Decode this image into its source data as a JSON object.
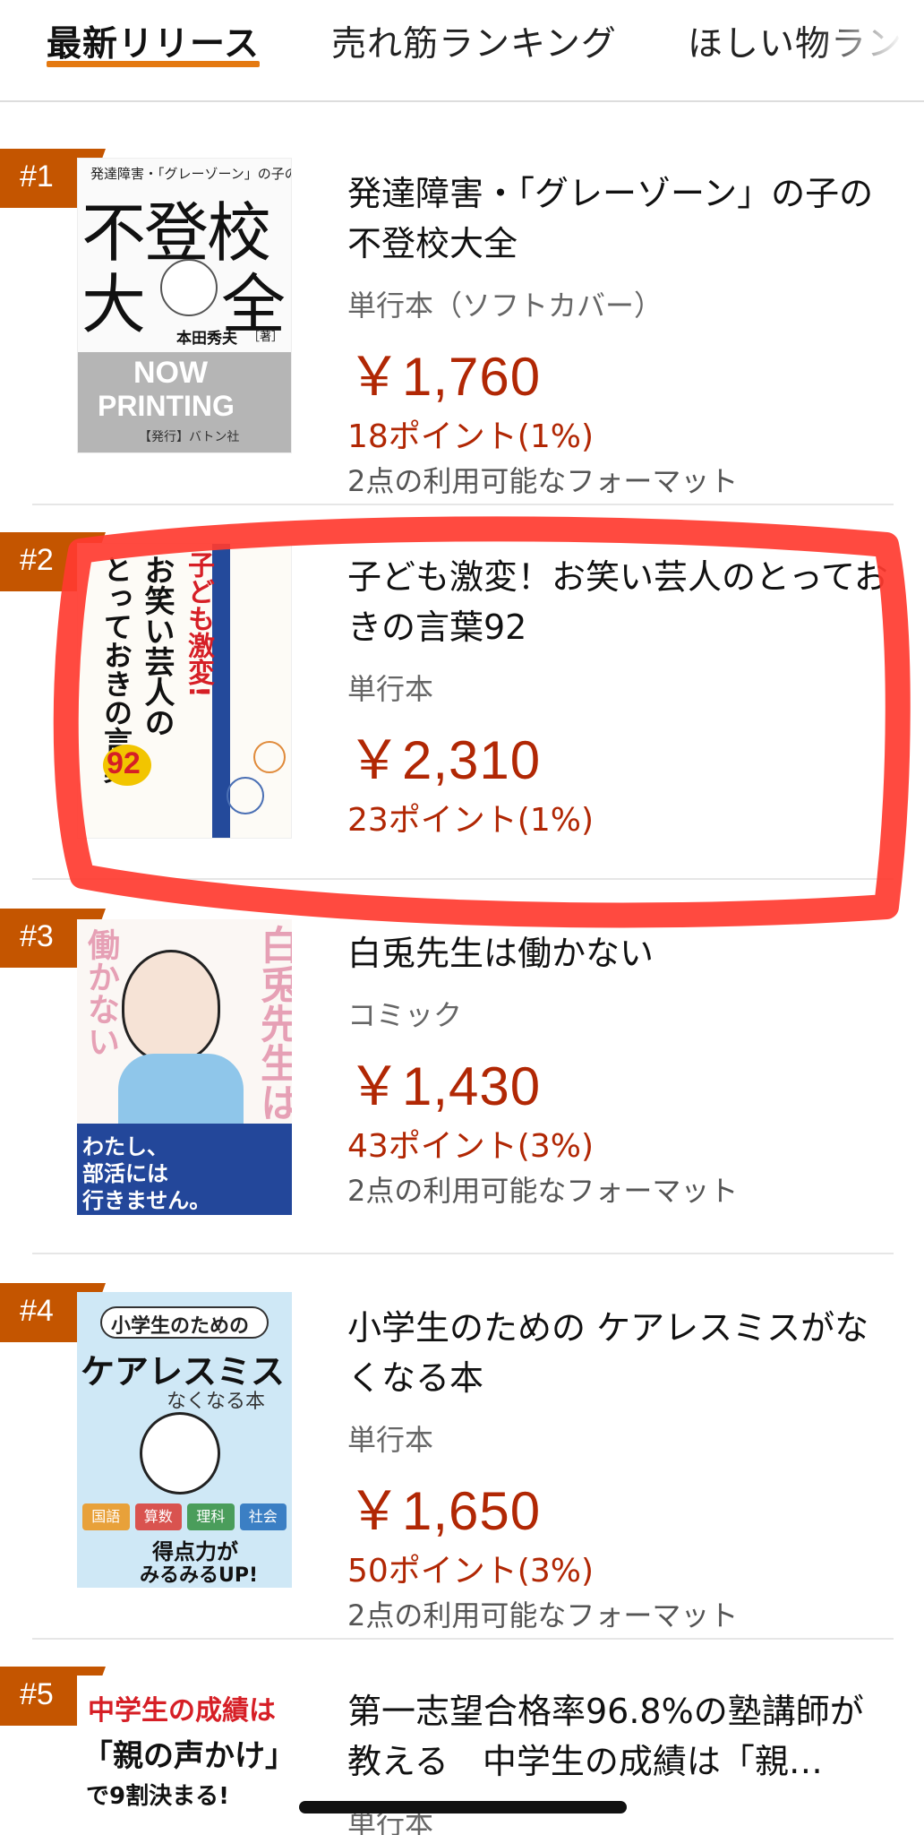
{
  "tabs": [
    {
      "label": "最新リリース"
    },
    {
      "label": "売れ筋ランキング"
    },
    {
      "label": "ほしい物ランキング"
    }
  ],
  "items": [
    {
      "rank": "#1",
      "title": "発達障害・「グレーゾーン」の子の不登校大全",
      "format": "単行本（ソフトカバー）",
      "price": "￥1,760",
      "points": "18ポイント(1%)",
      "availability": "2点の利用可能なフォーマット",
      "cover": {
        "top_text": "発達障害・「グレーゾーン」の子の",
        "big1": "不登校",
        "big2": "大",
        "big3": "全",
        "author": "本田秀夫",
        "author_suffix": "［著］",
        "now": "NOW",
        "printing": "PRINTING",
        "publisher": "【発行】バトン社"
      }
    },
    {
      "rank": "#2",
      "title": "子ども激変！お笑い芸人のとっておきの言葉92",
      "format": "単行本",
      "price": "￥2,310",
      "points": "23ポイント(1%)",
      "availability": "",
      "cover": {
        "line1": "子ども激変!",
        "line2": "お笑い芸人の",
        "line3": "とっておきの言葉",
        "num": "92"
      }
    },
    {
      "rank": "#3",
      "title": "白兎先生は働かない",
      "format": "コミック",
      "price": "￥1,430",
      "points": "43ポイント(3%)",
      "availability": "2点の利用可能なフォーマット",
      "cover": {
        "vtitle": "白兎先生は",
        "vsub": "働かない",
        "banner1": "わたし、",
        "banner2": "部活には",
        "banner3": "行きません。"
      }
    },
    {
      "rank": "#4",
      "title": "小学生のための ケアレスミスがなくなる本",
      "format": "単行本",
      "price": "￥1,650",
      "points": "50ポイント(3%)",
      "availability": "2点の利用可能なフォーマット",
      "cover": {
        "top": "小学生のための",
        "big": "ケアレスミス",
        "sub": "なくなる本",
        "subjects": [
          "国語",
          "算数",
          "理科",
          "社会"
        ],
        "tag1": "得点力が",
        "tag2": "みるみるUP!"
      }
    },
    {
      "rank": "#5",
      "title": "第一志望合格率96.8%の塾講師が教える　中学生の成績は「親…",
      "format": "単行本",
      "cover": {
        "l1": "中学生の成績は",
        "l2": "「親の声かけ」",
        "l3": "で9割決まる!"
      }
    }
  ],
  "colors": {
    "accent": "#e47911",
    "badge": "#c45500",
    "price": "#b12704",
    "highlight": "#ff3b30"
  }
}
